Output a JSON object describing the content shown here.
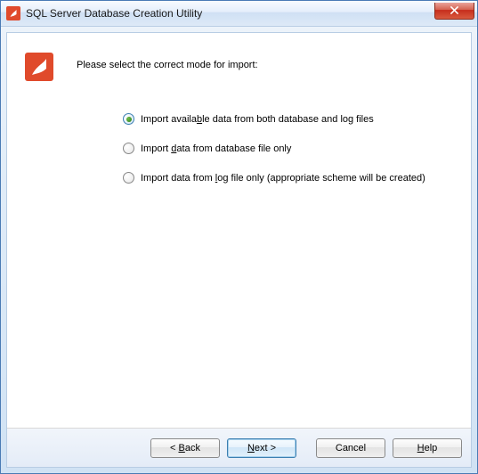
{
  "window": {
    "title": "SQL Server Database Creation Utility"
  },
  "prompt": "Please select the correct mode for import:",
  "options": [
    {
      "label": "Import available data from both database and log files",
      "mnemonic": "b",
      "selected": true
    },
    {
      "label": "Import data from database file only",
      "mnemonic": "d",
      "selected": false
    },
    {
      "label": "Import data from log file only (appropriate scheme will be created)",
      "mnemonic": "l",
      "selected": false
    }
  ],
  "buttons": {
    "back": "< Back",
    "next": "Next >",
    "cancel": "Cancel",
    "help": "Help"
  },
  "button_mnemonics": {
    "back": "B",
    "next": "N",
    "help": "H"
  }
}
